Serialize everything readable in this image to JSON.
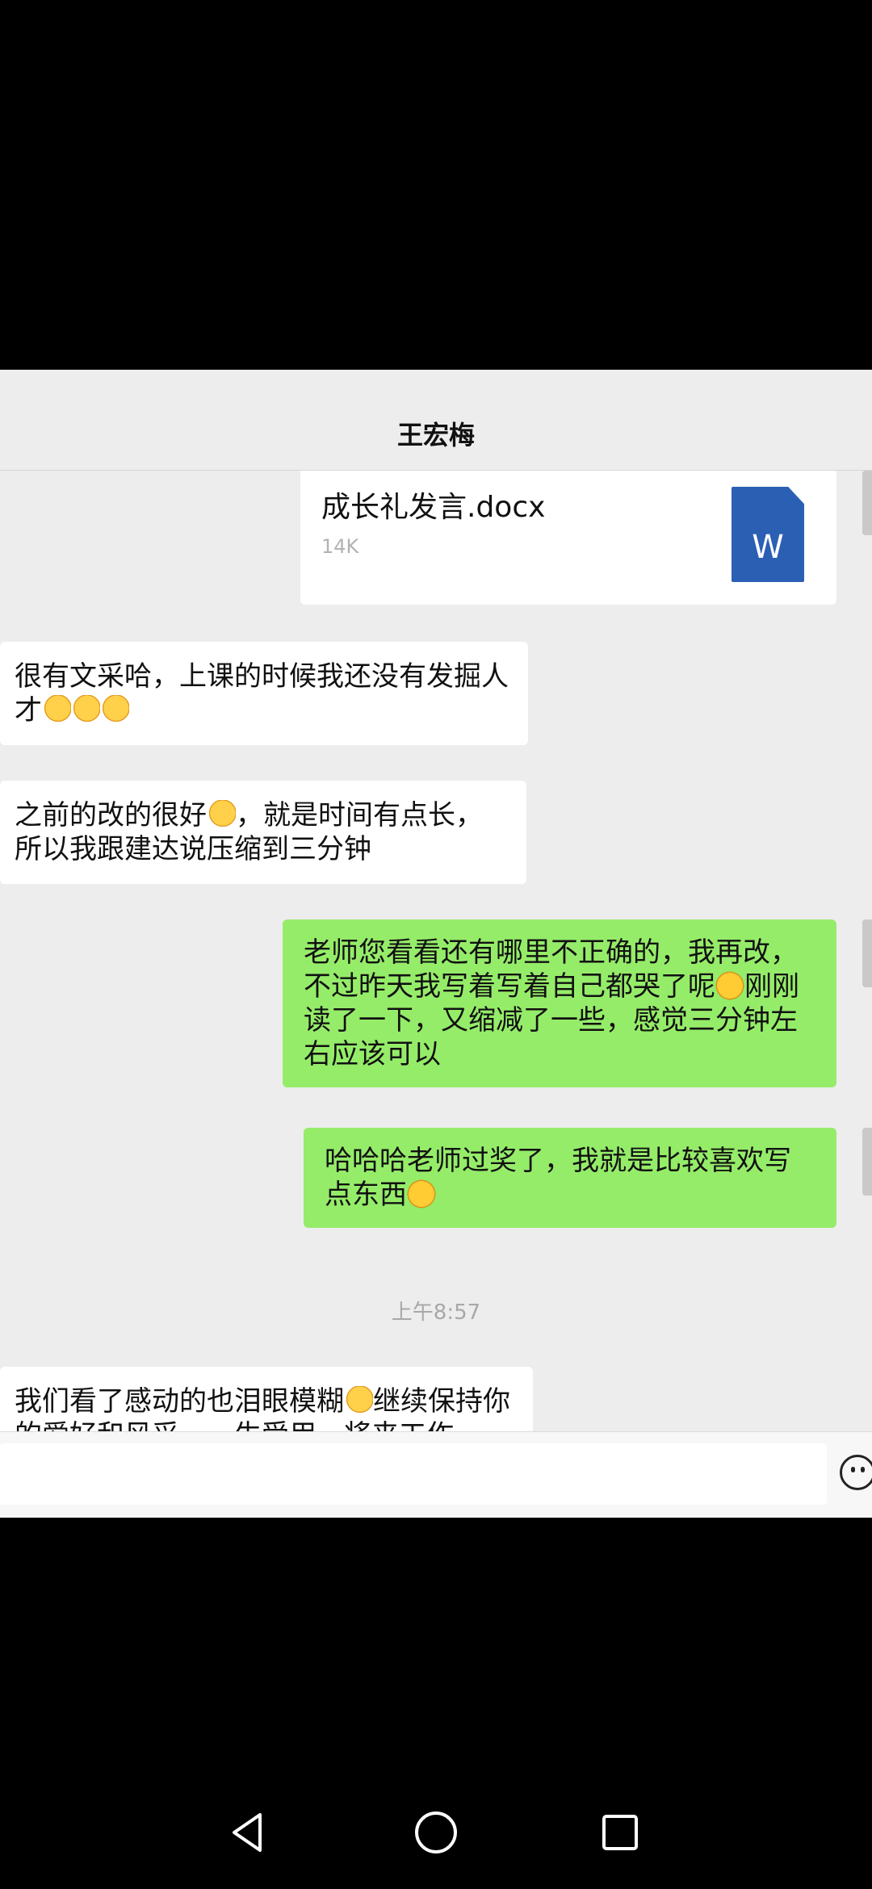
{
  "status": {
    "icons": [
      "wifi-icon"
    ]
  },
  "header": {
    "title": "王宏梅"
  },
  "messages": {
    "file": {
      "name": "成长礼发言.docx",
      "size": "14K",
      "icon_label": "W",
      "icon_color": "#2b5fb3"
    },
    "m1": {
      "text": "很有文采哈，上课的时候我还没有发掘人才",
      "emoji": [
        "thumbs-up-icon",
        "thumbs-up-icon",
        "thumbs-up-icon"
      ]
    },
    "m2": {
      "text_a": "之前的改的很好",
      "text_b": "，就是时间有点长，所以我跟建达说压缩到三分钟"
    },
    "m3": {
      "text_a": "老师您看看还有哪里不正确的，我再改，不过昨天我写着写着自己都哭了呢",
      "text_b": "刚刚读了一下，又缩减了一些，感觉三分钟左右应该可以"
    },
    "m4": {
      "text": "哈哈哈老师过奖了，我就是比较喜欢写点东西"
    },
    "time": "上午8:57",
    "m5": {
      "text_a": "我们看了感动的也泪眼模糊",
      "text_b": "继续保持你的爱好和风采，一生受用，将来工作"
    }
  },
  "colors": {
    "chat_bg": "#ededed",
    "self_bubble": "#95ec69",
    "other_bubble": "#ffffff"
  },
  "nav": {
    "buttons": [
      "back-icon",
      "home-icon",
      "recents-icon"
    ]
  }
}
